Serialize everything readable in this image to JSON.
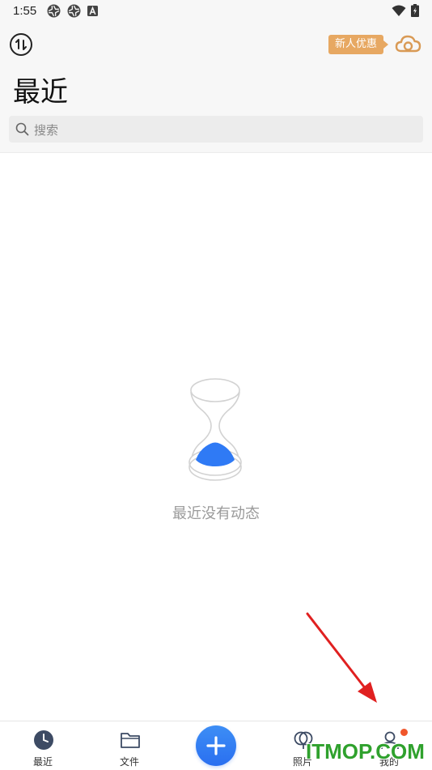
{
  "status_bar": {
    "time": "1:55"
  },
  "header": {
    "promo_label": "新人优惠",
    "title": "最近",
    "search": {
      "placeholder": "搜索"
    }
  },
  "empty_state": {
    "message": "最近没有动态"
  },
  "bottom_nav": {
    "items": [
      {
        "label": "最近",
        "icon": "clock-icon",
        "active": true
      },
      {
        "label": "文件",
        "icon": "folder-icon",
        "active": false
      },
      {
        "label": "照片",
        "icon": "photos-icon",
        "active": false
      },
      {
        "label": "我的",
        "icon": "person-icon",
        "active": false
      }
    ],
    "fab_icon": "plus-icon"
  },
  "watermark": "ITMOP.COM",
  "colors": {
    "accent": "#2a6ff0",
    "promo": "#e7a862",
    "badge": "#f0562b",
    "annotation_arrow": "#e02020",
    "watermark": "#2fa12d"
  }
}
